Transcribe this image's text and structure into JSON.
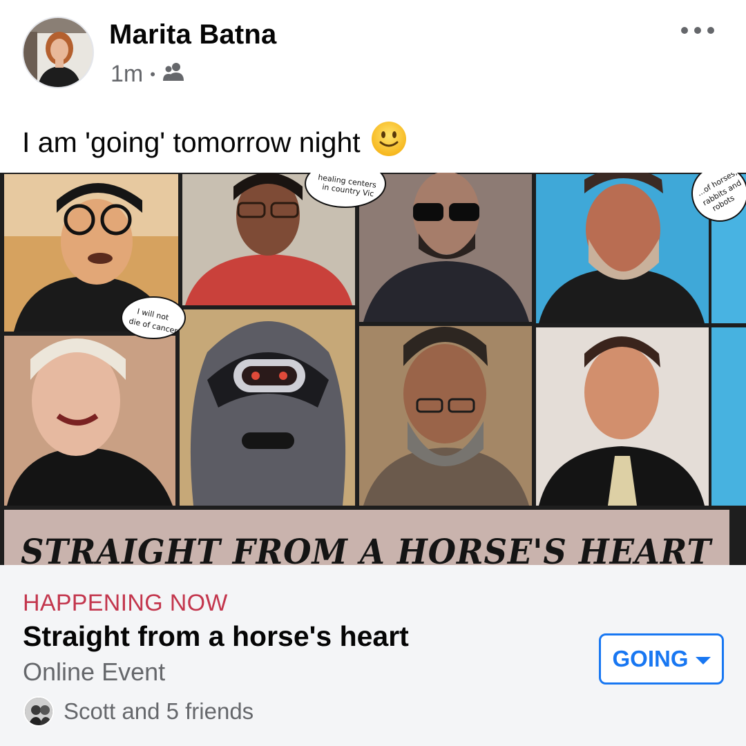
{
  "post": {
    "author": "Marita Batna",
    "time": "1m",
    "separator": "•",
    "audience_icon": "friends-icon",
    "text": "I am 'going' tomorrow night",
    "emoji": "slightly-smiling-face-icon",
    "more_icon": "more-horizontal-icon"
  },
  "event_image": {
    "banner_title": "STRAIGHT FROM A HORSE'S HEART",
    "bubbles": [
      "...istic healing centers in country Vic",
      "...of horses, rabbits and robots",
      "I will not die of cancer"
    ]
  },
  "event": {
    "status": "HAPPENING NOW",
    "title": "Straight from a horse's heart",
    "subtitle": "Online Event",
    "going_label": "GOING",
    "going_caret_icon": "caret-down-icon",
    "friends_text": "Scott and 5 friends"
  },
  "colors": {
    "accent": "#1877f2",
    "status": "#c3364d",
    "secondary_text": "#65676b",
    "card_bg": "#f4f5f7"
  }
}
